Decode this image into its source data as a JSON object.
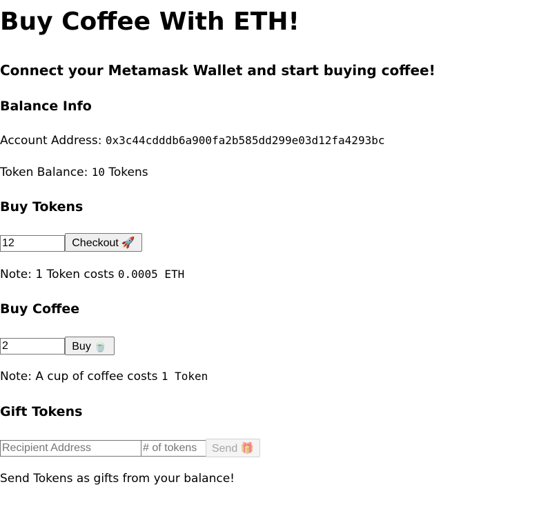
{
  "title": "Buy Coffee With ETH!",
  "subtitle": "Connect your Metamask Wallet and start buying coffee!",
  "balance": {
    "heading": "Balance Info",
    "address_label": "Account Address: ",
    "address": "0x3c44cdddb6a900fa2b585dd299e03d12fa4293bc",
    "token_label": "Token Balance: ",
    "token_count": "10",
    "token_unit": " Tokens"
  },
  "buy_tokens": {
    "heading": "Buy Tokens",
    "input_value": "12",
    "button_label": "Checkout",
    "button_icon": "🚀",
    "note_label": "Note: 1 Token costs ",
    "note_value": "0.0005 ETH"
  },
  "buy_coffee": {
    "heading": "Buy Coffee",
    "input_value": "2",
    "button_label": "Buy",
    "button_icon": "🍵",
    "note_label": "Note: A cup of coffee costs ",
    "note_value": "1 Token"
  },
  "gift": {
    "heading": "Gift Tokens",
    "recipient_placeholder": "Recipient Address",
    "amount_placeholder": "# of tokens",
    "button_label": "Send",
    "button_icon": "🎁",
    "footer": "Send Tokens as gifts from your balance!"
  }
}
